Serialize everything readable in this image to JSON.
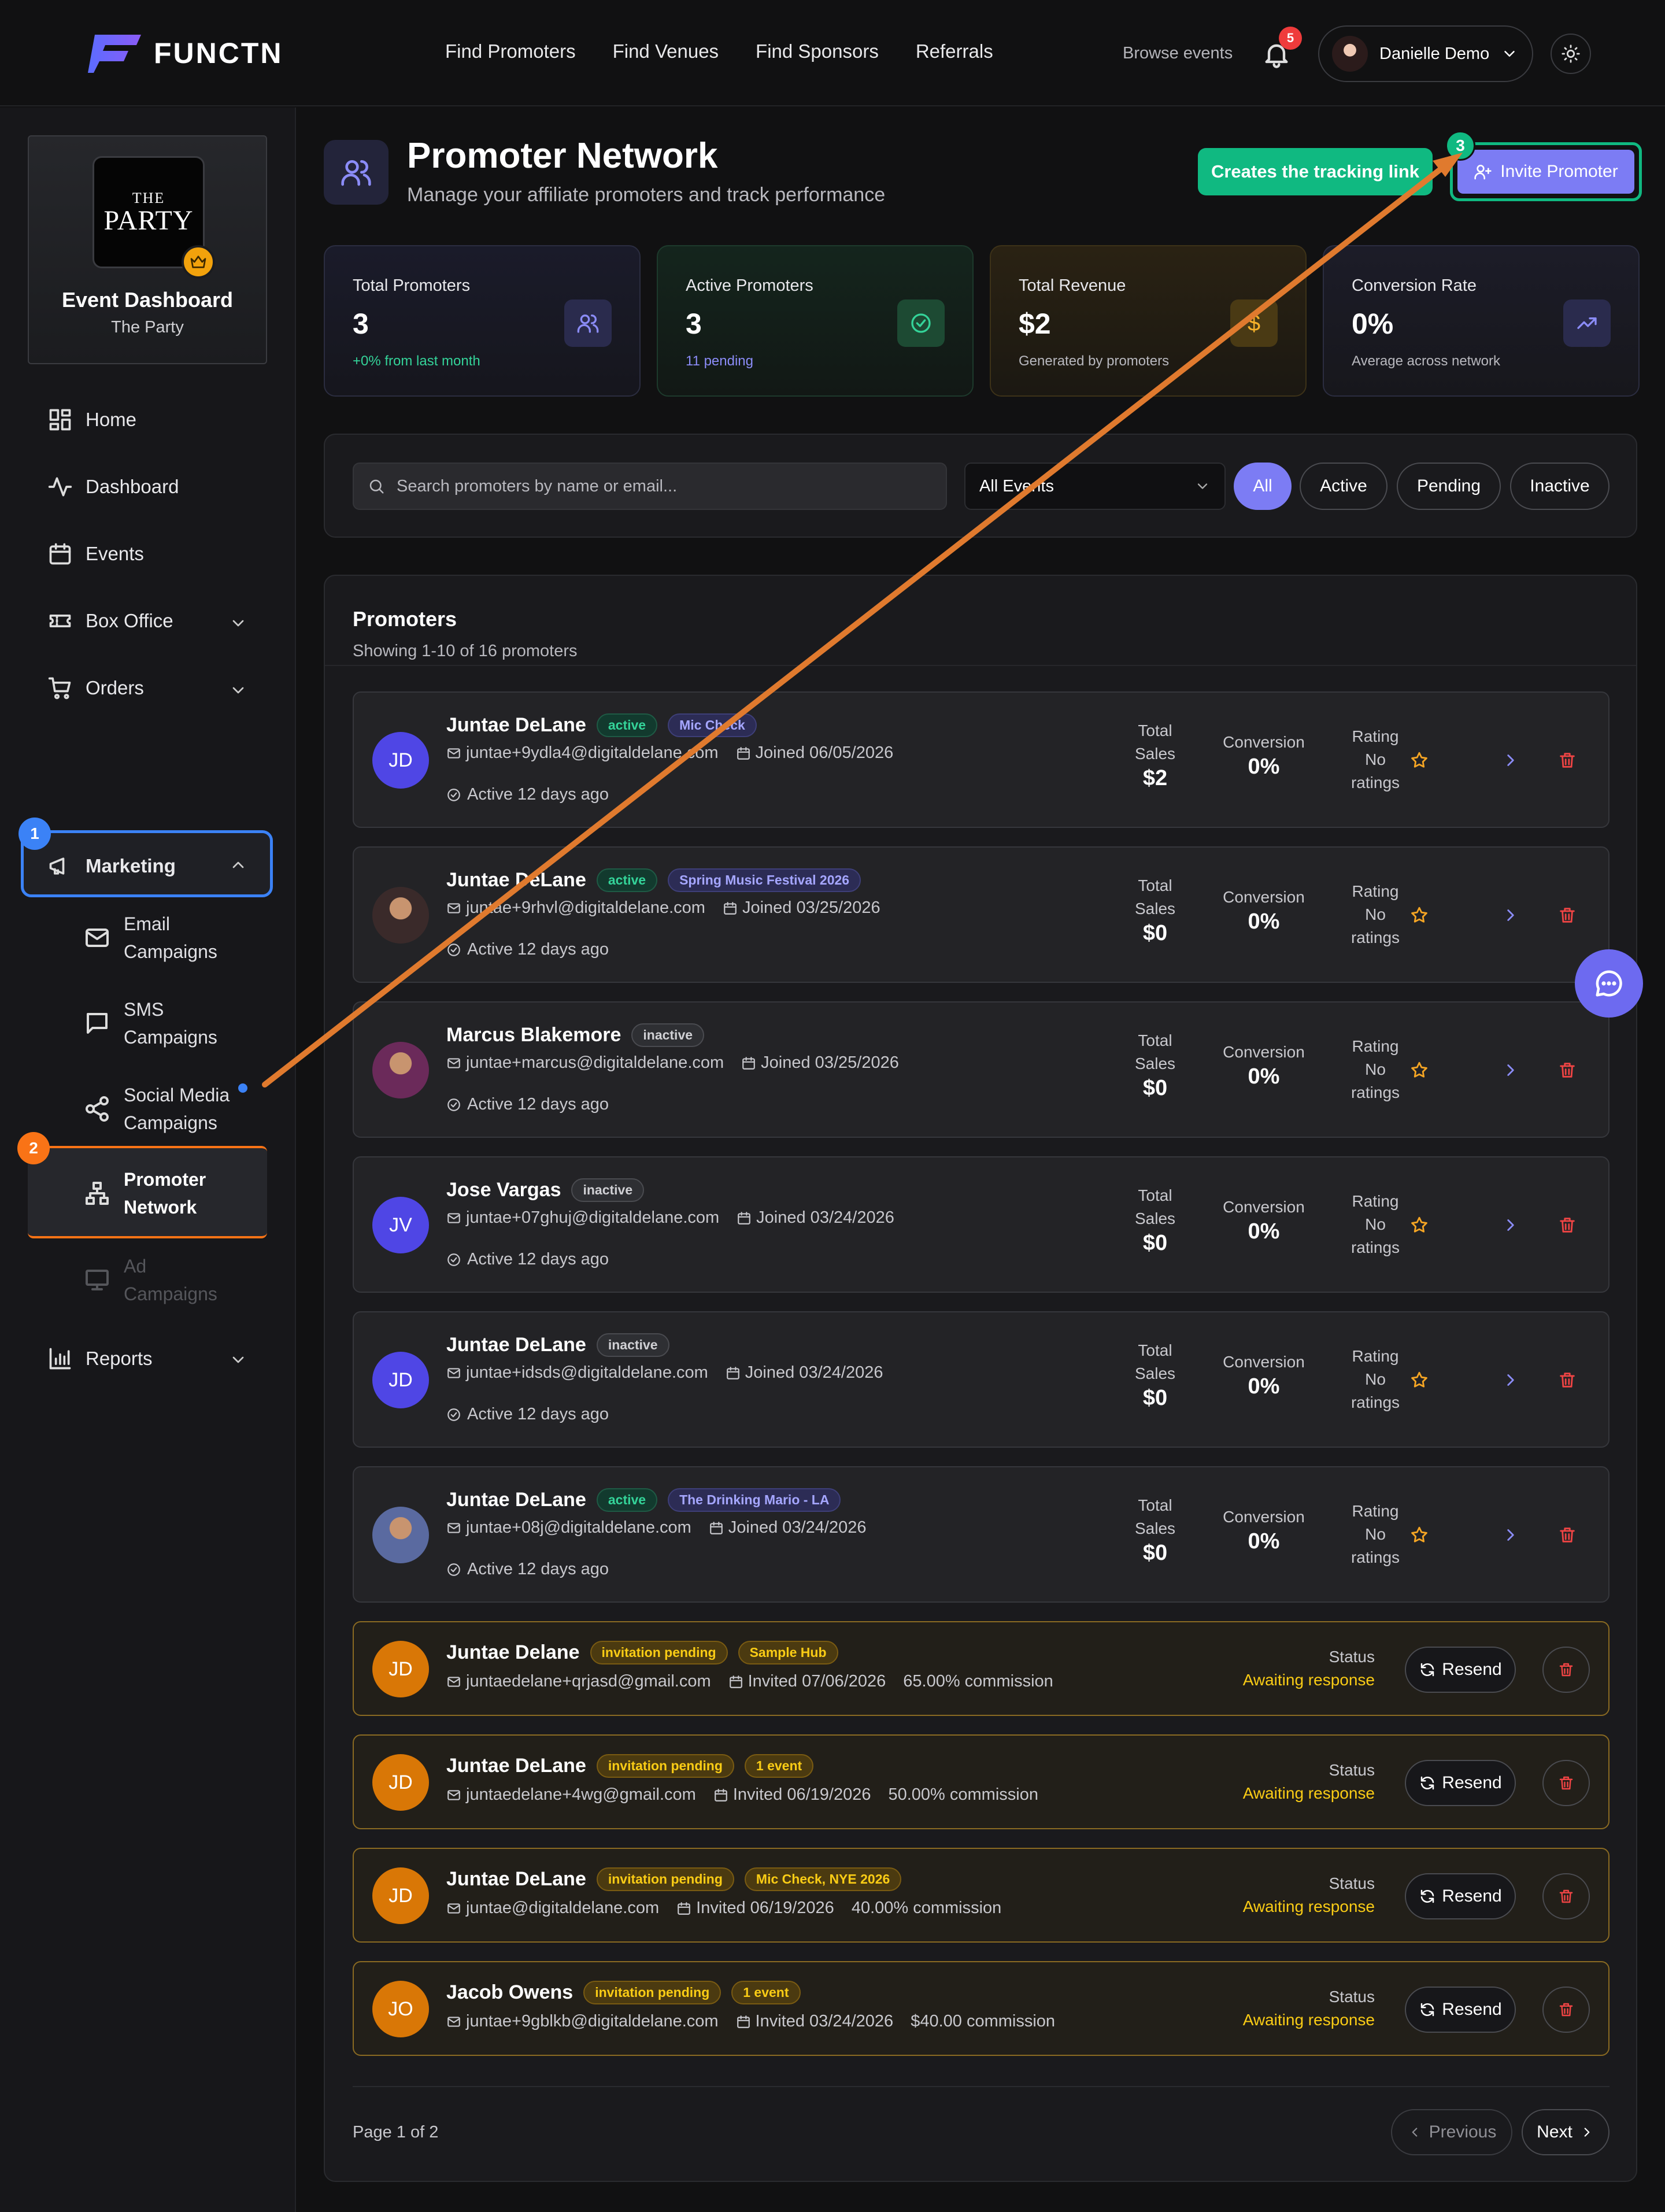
{
  "header": {
    "brand": "FUNCTN",
    "nav": [
      "Find Promoters",
      "Find Venues",
      "Find Sponsors",
      "Referrals"
    ],
    "browse_events": "Browse events",
    "notifications_count": "5",
    "user_name": "Danielle Demo"
  },
  "sidebar": {
    "event_logo_line1": "THE",
    "event_logo_line2": "PARTY",
    "event_title": "Event Dashboard",
    "event_subtitle": "The Party",
    "items": {
      "home": "Home",
      "dashboard": "Dashboard",
      "events": "Events",
      "box_office": "Box Office",
      "orders": "Orders",
      "marketing": "Marketing",
      "email_1": "Email",
      "email_2": "Campaigns",
      "sms_1": "SMS",
      "sms_2": "Campaigns",
      "social_1": "Social Media",
      "social_2": "Campaigns",
      "promoter_1": "Promoter",
      "promoter_2": "Network",
      "ad_1": "Ad",
      "ad_2": "Campaigns",
      "reports": "Reports"
    }
  },
  "annotations": {
    "step1": "1",
    "step2": "2",
    "step3": "3",
    "tooltip": "Creates the tracking link"
  },
  "page": {
    "title": "Promoter Network",
    "subtitle": "Manage your affiliate promoters and track performance",
    "invite_button": "Invite Promoter"
  },
  "stats": [
    {
      "label": "Total Promoters",
      "value": "3",
      "note": "+0% from last month"
    },
    {
      "label": "Active Promoters",
      "value": "3",
      "note": "11 pending"
    },
    {
      "label": "Total Revenue",
      "value": "$2",
      "note": "Generated by promoters"
    },
    {
      "label": "Conversion Rate",
      "value": "0%",
      "note": "Average across network"
    }
  ],
  "filters": {
    "search_placeholder": "Search promoters by name or email...",
    "event_select": "All Events",
    "pills": [
      "All",
      "Active",
      "Pending",
      "Inactive"
    ]
  },
  "list": {
    "title": "Promoters",
    "subtitle": "Showing 1-10 of 16 promoters",
    "labels": {
      "total": "Total",
      "sales": "Sales",
      "conversion": "Conversion",
      "rating": "Rating",
      "no": "No",
      "ratings": "ratings",
      "status": "Status",
      "awaiting": "Awaiting response",
      "resend": "Resend"
    },
    "promoters": [
      {
        "initials": "JD",
        "name": "Juntae DeLane",
        "status": "active",
        "event": "Mic Check",
        "email": "juntae+9ydla4@digitaldelane.com",
        "joined": "Joined 06/05/2026",
        "activity": "Active 12 days ago",
        "sales": "$2",
        "conversion": "0%"
      },
      {
        "initials": "",
        "name": "Juntae DeLane",
        "status": "active",
        "event": "Spring Music Festival 2026",
        "email": "juntae+9rhvl@digitaldelane.com",
        "joined": "Joined 03/25/2026",
        "activity": "Active 12 days ago",
        "sales": "$0",
        "conversion": "0%"
      },
      {
        "initials": "",
        "name": "Marcus Blakemore",
        "status": "inactive",
        "event": "",
        "email": "juntae+marcus@digitaldelane.com",
        "joined": "Joined 03/25/2026",
        "activity": "Active 12 days ago",
        "sales": "$0",
        "conversion": "0%"
      },
      {
        "initials": "JV",
        "name": "Jose Vargas",
        "status": "inactive",
        "event": "",
        "email": "juntae+07ghuj@digitaldelane.com",
        "joined": "Joined 03/24/2026",
        "activity": "Active 12 days ago",
        "sales": "$0",
        "conversion": "0%"
      },
      {
        "initials": "JD",
        "name": "Juntae DeLane",
        "status": "inactive",
        "event": "",
        "email": "juntae+idsds@digitaldelane.com",
        "joined": "Joined 03/24/2026",
        "activity": "Active 12 days ago",
        "sales": "$0",
        "conversion": "0%"
      },
      {
        "initials": "",
        "name": "Juntae DeLane",
        "status": "active",
        "event": "The Drinking Mario - LA",
        "email": "juntae+08j@digitaldelane.com",
        "joined": "Joined 03/24/2026",
        "activity": "Active 12 days ago",
        "sales": "$0",
        "conversion": "0%"
      }
    ],
    "pending": [
      {
        "initials": "JD",
        "name": "Juntae Delane",
        "badge": "invitation pending",
        "event": "Sample Hub",
        "email": "juntaedelane+qrjasd@gmail.com",
        "invited": "Invited 07/06/2026",
        "commission": "65.00% commission"
      },
      {
        "initials": "JD",
        "name": "Juntae DeLane",
        "badge": "invitation pending",
        "event": "1 event",
        "email": "juntaedelane+4wg@gmail.com",
        "invited": "Invited 06/19/2026",
        "commission": "50.00% commission"
      },
      {
        "initials": "JD",
        "name": "Juntae DeLane",
        "badge": "invitation pending",
        "event": "Mic Check, NYE 2026",
        "email": "juntae@digitaldelane.com",
        "invited": "Invited 06/19/2026",
        "commission": "40.00% commission"
      },
      {
        "initials": "JO",
        "name": "Jacob Owens",
        "badge": "invitation pending",
        "event": "1 event",
        "email": "juntae+9gblkb@digitaldelane.com",
        "invited": "Invited 03/24/2026",
        "commission": "$40.00 commission"
      }
    ],
    "page_info": "Page 1 of 2",
    "previous": "Previous",
    "next": "Next"
  },
  "colors": {
    "accent": "#7c7cf4",
    "active_badge": "#34d399",
    "pending_badge": "#facc15",
    "danger": "#ef4444",
    "annotation_green": "#10b981",
    "annotation_blue": "#3b82f6",
    "annotation_orange": "#f97316"
  }
}
